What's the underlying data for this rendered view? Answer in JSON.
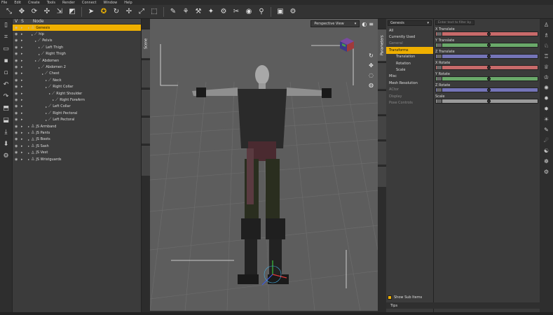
{
  "menu": [
    "File",
    "Edit",
    "Create",
    "Tools",
    "Render",
    "Connect",
    "Window",
    "Help"
  ],
  "toolbar_icons": [
    "node-selection-icon",
    "universal-tool-icon",
    "rotate-tool-icon",
    "translate-tool-icon",
    "scale-tool-icon",
    "transform-tool-icon",
    "surface-selection-icon",
    "joint-editor-icon",
    "spot-render-icon",
    "region-navigator-icon",
    "pose-tool-icon",
    "figure-tool-icon",
    "render-icon",
    "render-settings-icon"
  ],
  "scene": {
    "col_v": "V",
    "col_s": "S",
    "col_node": "Node",
    "rows": [
      {
        "label": "Genesis",
        "indent": 0,
        "selected": true,
        "type": "figure"
      },
      {
        "label": "hip",
        "indent": 1,
        "type": "bone"
      },
      {
        "label": "Pelvis",
        "indent": 2,
        "type": "bone"
      },
      {
        "label": "Left Thigh",
        "indent": 3,
        "type": "bone"
      },
      {
        "label": "Right Thigh",
        "indent": 3,
        "type": "bone"
      },
      {
        "label": "Abdomen",
        "indent": 2,
        "type": "bone"
      },
      {
        "label": "Abdomen 2",
        "indent": 3,
        "type": "bone"
      },
      {
        "label": "Chest",
        "indent": 4,
        "type": "bone"
      },
      {
        "label": "Neck",
        "indent": 5,
        "type": "bone"
      },
      {
        "label": "Right Collar",
        "indent": 5,
        "type": "bone"
      },
      {
        "label": "Right Shoulder",
        "indent": 6,
        "type": "bone"
      },
      {
        "label": "Right ForeArm",
        "indent": 7,
        "type": "bone"
      },
      {
        "label": "Left Collar",
        "indent": 5,
        "type": "bone"
      },
      {
        "label": "Right Pectoral",
        "indent": 5,
        "type": "bone"
      },
      {
        "label": "Left Pectoral",
        "indent": 5,
        "type": "bone"
      },
      {
        "label": "JS Armband",
        "indent": 0,
        "type": "figure"
      },
      {
        "label": "JS Pants",
        "indent": 0,
        "type": "figure"
      },
      {
        "label": "JS Boots",
        "indent": 0,
        "type": "figure"
      },
      {
        "label": "JS Sash",
        "indent": 0,
        "type": "figure"
      },
      {
        "label": "JS Vest",
        "indent": 0,
        "type": "figure"
      },
      {
        "label": "JS Wristguards",
        "indent": 0,
        "type": "figure"
      }
    ]
  },
  "scene_tab": "Scene",
  "viewport": {
    "camera": "Perspective View"
  },
  "right_tab": "Parameters",
  "params": {
    "figure": "Genesis",
    "items": [
      {
        "label": "All",
        "style": "normal"
      },
      {
        "label": "Currently Used",
        "style": "normal"
      },
      {
        "label": "General",
        "style": "dim"
      },
      {
        "label": "Transforms",
        "style": "sel"
      },
      {
        "label": "Translation",
        "style": "sub"
      },
      {
        "label": "Rotation",
        "style": "sub"
      },
      {
        "label": "Scale",
        "style": "sub"
      },
      {
        "label": "Misc",
        "style": "normal"
      },
      {
        "label": "Mesh Resolution",
        "style": "normal"
      },
      {
        "label": "ACtor",
        "style": "dim"
      },
      {
        "label": "Display",
        "style": "dim"
      },
      {
        "label": "Pose Controls",
        "style": "dim"
      }
    ],
    "show_sub": "Show Sub Items"
  },
  "sliders": {
    "filter_placeholder": "Enter text to filter by",
    "items": [
      {
        "label": "X Translate",
        "color": "#c86a6a"
      },
      {
        "label": "Y Translate",
        "color": "#6aa96a"
      },
      {
        "label": "Z Translate",
        "color": "#7575b8"
      },
      {
        "label": "X Rotate",
        "color": "#c86a6a"
      },
      {
        "label": "Y Rotate",
        "color": "#6aa96a"
      },
      {
        "label": "Z Rotate",
        "color": "#7575b8"
      },
      {
        "label": "Scale",
        "color": "#9a9a9a"
      }
    ]
  },
  "tips": "Tips"
}
